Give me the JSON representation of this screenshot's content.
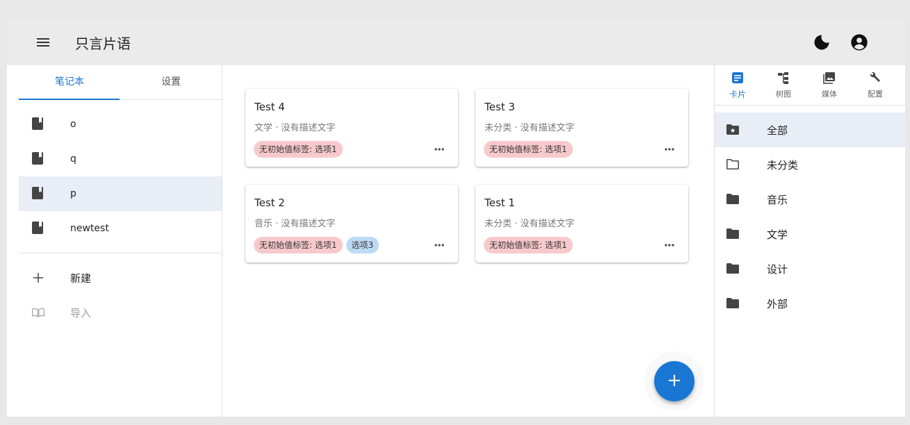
{
  "app": {
    "title": "只言片语"
  },
  "left_panel": {
    "tabs": [
      {
        "label": "笔记本"
      },
      {
        "label": "设置"
      }
    ],
    "notebooks": [
      {
        "label": "o"
      },
      {
        "label": "q"
      },
      {
        "label": "p"
      },
      {
        "label": "newtest"
      }
    ],
    "actions": [
      {
        "label": "新建"
      },
      {
        "label": "导入"
      }
    ]
  },
  "cards": [
    {
      "title": "Test 4",
      "subtitle": "文学 · 没有描述文字",
      "chips": [
        {
          "label": "无初始值标签: 选项1",
          "color": "#f8c9cc"
        }
      ]
    },
    {
      "title": "Test 3",
      "subtitle": "未分类 · 没有描述文字",
      "chips": [
        {
          "label": "无初始值标签: 选项1",
          "color": "#f8c9cc"
        }
      ]
    },
    {
      "title": "Test 2",
      "subtitle": "音乐 · 没有描述文字",
      "chips": [
        {
          "label": "无初始值标签: 选项1",
          "color": "#f8c9cc"
        },
        {
          "label": "选项3",
          "color": "#bcdaf5"
        }
      ]
    },
    {
      "title": "Test 1",
      "subtitle": "未分类 · 没有描述文字",
      "chips": [
        {
          "label": "无初始值标签: 选项1",
          "color": "#f8c9cc"
        }
      ]
    }
  ],
  "fab": {
    "label": "+"
  },
  "right_panel": {
    "tabs": [
      {
        "label": "卡片",
        "icon": "cards-icon"
      },
      {
        "label": "树图",
        "icon": "tree-icon"
      },
      {
        "label": "媒体",
        "icon": "media-icon"
      },
      {
        "label": "配置",
        "icon": "wrench-icon"
      }
    ],
    "categories": [
      {
        "label": "全部",
        "icon": "folder-star-icon"
      },
      {
        "label": "未分类",
        "icon": "folder-outline-icon"
      },
      {
        "label": "音乐",
        "icon": "folder-icon"
      },
      {
        "label": "文学",
        "icon": "folder-icon"
      },
      {
        "label": "设计",
        "icon": "folder-icon"
      },
      {
        "label": "外部",
        "icon": "folder-icon"
      }
    ]
  },
  "colors": {
    "accent": "#1976d2",
    "selected_bg": "#e8edf6",
    "appbar_bg": "#ebebeb"
  }
}
